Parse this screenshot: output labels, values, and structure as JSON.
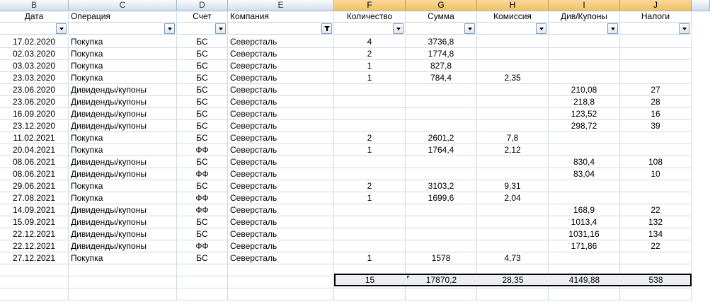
{
  "columns": [
    {
      "letter": "B",
      "header": "Дата"
    },
    {
      "letter": "C",
      "header": "Операция"
    },
    {
      "letter": "D",
      "header": "Счет"
    },
    {
      "letter": "E",
      "header": "Компания"
    },
    {
      "letter": "F",
      "header": "Количество"
    },
    {
      "letter": "G",
      "header": "Сумма"
    },
    {
      "letter": "H",
      "header": "Комиссия"
    },
    {
      "letter": "I",
      "header": "Див/Купоны"
    },
    {
      "letter": "J",
      "header": "Налоги"
    }
  ],
  "filter": {
    "active_column": "E"
  },
  "rows": [
    {
      "date": "17.02.2020",
      "op": "Покупка",
      "acct": "БС",
      "company": "Северсталь",
      "qty": "4",
      "sum": "3736,8",
      "fee": "",
      "div": "",
      "tax": ""
    },
    {
      "date": "02.03.2020",
      "op": "Покупка",
      "acct": "БС",
      "company": "Северсталь",
      "qty": "2",
      "sum": "1774,8",
      "fee": "",
      "div": "",
      "tax": ""
    },
    {
      "date": "03.03.2020",
      "op": "Покупка",
      "acct": "БС",
      "company": "Северсталь",
      "qty": "1",
      "sum": "827,8",
      "fee": "",
      "div": "",
      "tax": ""
    },
    {
      "date": "23.03.2020",
      "op": "Покупка",
      "acct": "БС",
      "company": "Северсталь",
      "qty": "1",
      "sum": "784,4",
      "fee": "2,35",
      "div": "",
      "tax": ""
    },
    {
      "date": "23.06.2020",
      "op": "Дивиденды/купоны",
      "acct": "БС",
      "company": "Северсталь",
      "qty": "",
      "sum": "",
      "fee": "",
      "div": "210,08",
      "tax": "27"
    },
    {
      "date": "23.06.2020",
      "op": "Дивиденды/купоны",
      "acct": "БС",
      "company": "Северсталь",
      "qty": "",
      "sum": "",
      "fee": "",
      "div": "218,8",
      "tax": "28"
    },
    {
      "date": "16.09.2020",
      "op": "Дивиденды/купоны",
      "acct": "БС",
      "company": "Северсталь",
      "qty": "",
      "sum": "",
      "fee": "",
      "div": "123,52",
      "tax": "16"
    },
    {
      "date": "23.12.2020",
      "op": "Дивиденды/купоны",
      "acct": "БС",
      "company": "Северсталь",
      "qty": "",
      "sum": "",
      "fee": "",
      "div": "298,72",
      "tax": "39"
    },
    {
      "date": "11.02.2021",
      "op": "Покупка",
      "acct": "БС",
      "company": "Северсталь",
      "qty": "2",
      "sum": "2601,2",
      "fee": "7,8",
      "div": "",
      "tax": ""
    },
    {
      "date": "20.04.2021",
      "op": "Покупка",
      "acct": "ФФ",
      "company": "Северсталь",
      "qty": "1",
      "sum": "1764,4",
      "fee": "2,12",
      "div": "",
      "tax": ""
    },
    {
      "date": "08.06.2021",
      "op": "Дивиденды/купоны",
      "acct": "БС",
      "company": "Северсталь",
      "qty": "",
      "sum": "",
      "fee": "",
      "div": "830,4",
      "tax": "108"
    },
    {
      "date": "08.06.2021",
      "op": "Дивиденды/купоны",
      "acct": "ФФ",
      "company": "Северсталь",
      "qty": "",
      "sum": "",
      "fee": "",
      "div": "83,04",
      "tax": "10"
    },
    {
      "date": "29.06.2021",
      "op": "Покупка",
      "acct": "БС",
      "company": "Северсталь",
      "qty": "2",
      "sum": "3103,2",
      "fee": "9,31",
      "div": "",
      "tax": ""
    },
    {
      "date": "27.08.2021",
      "op": "Покупка",
      "acct": "ФФ",
      "company": "Северсталь",
      "qty": "1",
      "sum": "1699,6",
      "fee": "2,04",
      "div": "",
      "tax": ""
    },
    {
      "date": "14.09.2021",
      "op": "Дивиденды/купоны",
      "acct": "ФФ",
      "company": "Северсталь",
      "qty": "",
      "sum": "",
      "fee": "",
      "div": "168,9",
      "tax": "22"
    },
    {
      "date": "15.09.2021",
      "op": "Дивиденды/купоны",
      "acct": "БС",
      "company": "Северсталь",
      "qty": "",
      "sum": "",
      "fee": "",
      "div": "1013,4",
      "tax": "132"
    },
    {
      "date": "22.12.2021",
      "op": "Дивиденды/купоны",
      "acct": "БС",
      "company": "Северсталь",
      "qty": "",
      "sum": "",
      "fee": "",
      "div": "1031,16",
      "tax": "134"
    },
    {
      "date": "22.12.2021",
      "op": "Дивиденды/купоны",
      "acct": "ФФ",
      "company": "Северсталь",
      "qty": "",
      "sum": "",
      "fee": "",
      "div": "171,86",
      "tax": "22"
    },
    {
      "date": "27.12.2021",
      "op": "Покупка",
      "acct": "БС",
      "company": "Северсталь",
      "qty": "1",
      "sum": "1578",
      "fee": "4,73",
      "div": "",
      "tax": ""
    }
  ],
  "totals": {
    "qty": "15",
    "sum": "17870,2",
    "fee": "28,35",
    "div": "4149,88",
    "tax": "538"
  },
  "colors": {
    "grid": "#d0d7e5",
    "header_bg": "#dfe6f0",
    "selected_header": "#f5c96f"
  }
}
